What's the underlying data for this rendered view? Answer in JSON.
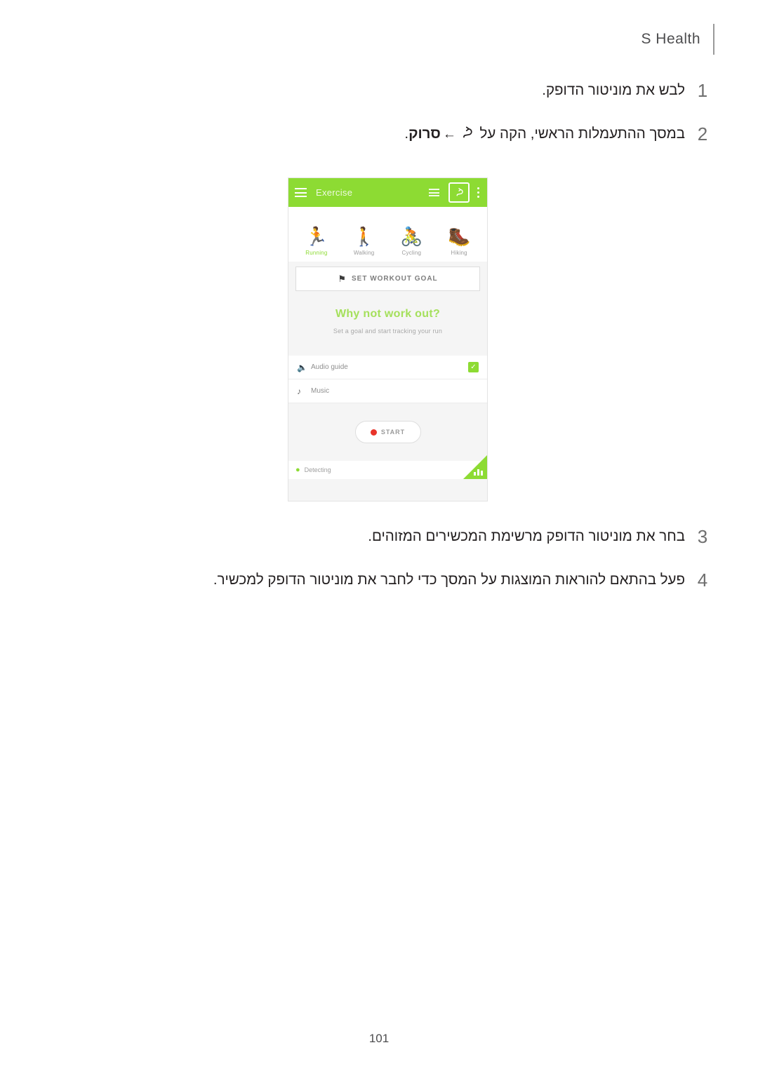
{
  "header": {
    "title": "S Health"
  },
  "steps": [
    {
      "num": "1",
      "text": "לבש את מוניטור הדופק.",
      "parts": null
    },
    {
      "num": "2",
      "pre": "במסך ההתעמלות הראשי, הקה על ",
      "icon": "exercise-link-icon",
      "mid": " ← ",
      "bold": "סרוק",
      "post": "."
    },
    {
      "num": "3",
      "text": "בחר את מוניטור הדופק מרשימת המכשירים המזוהים."
    },
    {
      "num": "4",
      "text": "פעל בהתאם להוראות המוצגות על המסך כדי לחבר את מוניטור הדופק למכשיר."
    }
  ],
  "phone": {
    "app_bar": {
      "menu_icon": "hamburger-icon",
      "title": "Exercise",
      "list_icon": "list-icon",
      "link_icon": "link-icon",
      "overflow_icon": "more-options-icon"
    },
    "activities": [
      {
        "name": "Running",
        "glyph": "🏃",
        "active": true
      },
      {
        "name": "Walking",
        "glyph": "🚶",
        "active": false
      },
      {
        "name": "Cycling",
        "glyph": "🚴",
        "active": false
      },
      {
        "name": "Hiking",
        "glyph": "🥾",
        "active": false
      }
    ],
    "goal_button": {
      "icon": "flag-icon",
      "label": "SET WORKOUT GOAL"
    },
    "promo": {
      "title": "Why not work out?",
      "subtitle": "Set a goal and start tracking your run"
    },
    "options": [
      {
        "icon": "speaker-icon",
        "label": "Audio guide",
        "checked": true
      },
      {
        "icon": "music-note-icon",
        "label": "Music",
        "checked": false
      }
    ],
    "start_button": {
      "label": "START"
    },
    "status": {
      "icon": "location-pin-icon",
      "text": "Detecting"
    }
  },
  "page_number": "101",
  "colors": {
    "accent_green": "#8ddb33",
    "header_gray": "#4d4d4f",
    "record_red": "#e8342a"
  }
}
